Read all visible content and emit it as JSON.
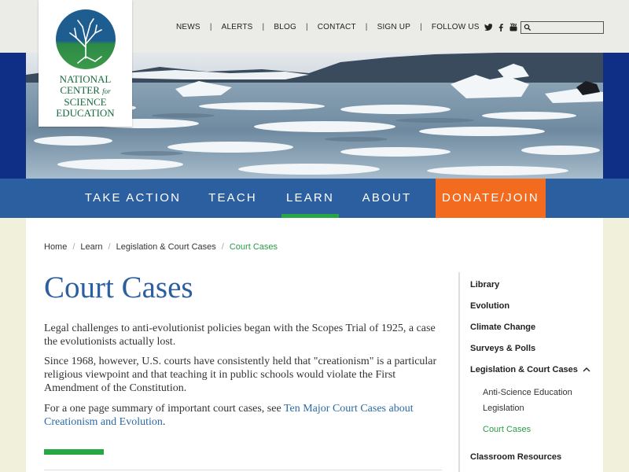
{
  "logo": {
    "line1": "NATIONAL",
    "line2": "CENTER",
    "line2_for": "for",
    "line3": "SCIENCE",
    "line4": "EDUCATION",
    "icon": "tree-icon"
  },
  "topnav": {
    "items": [
      "NEWS",
      "ALERTS",
      "BLOG",
      "CONTACT",
      "SIGN UP"
    ],
    "follow_label": "FOLLOW US",
    "social_icons": [
      "twitter-icon",
      "facebook-icon",
      "youtube-icon"
    ],
    "search_placeholder": ""
  },
  "mainnav": {
    "items": [
      "TAKE ACTION",
      "TEACH",
      "LEARN",
      "ABOUT",
      "DONATE/JOIN"
    ],
    "active": "LEARN"
  },
  "breadcrumb": [
    "Home",
    "Learn",
    "Legislation & Court Cases",
    "Court Cases"
  ],
  "page": {
    "title": "Court Cases",
    "p1": "Legal challenges to anti-evolutionist policies began with the Scopes Trial of 1925, a case the evolutionists actually lost.",
    "p2": "Since 1968, however, U.S. courts have consistently held that \"creationism\" is a particular religious viewpoint and that teaching it in public schools would violate the First Amendment of the Constitution.",
    "p3_prefix": "For a one page summary of important court cases, see ",
    "p3_link": "Ten Major Court Cases about Creationism and Evolution",
    "p3_suffix": "."
  },
  "sidebar": {
    "items": [
      "Library",
      "Evolution",
      "Climate Change",
      "Surveys & Polls",
      "Legislation & Court Cases"
    ],
    "subitems": [
      "Anti-Science Education Legislation",
      "Court Cases"
    ],
    "after": "Classroom Resources"
  },
  "colors": {
    "nav_blue": "#2b5f9f",
    "accent_green": "#25a844",
    "donate_orange": "#f26b1f",
    "hero_band": "#0f2f86",
    "page_bg": "#f1f0db"
  }
}
